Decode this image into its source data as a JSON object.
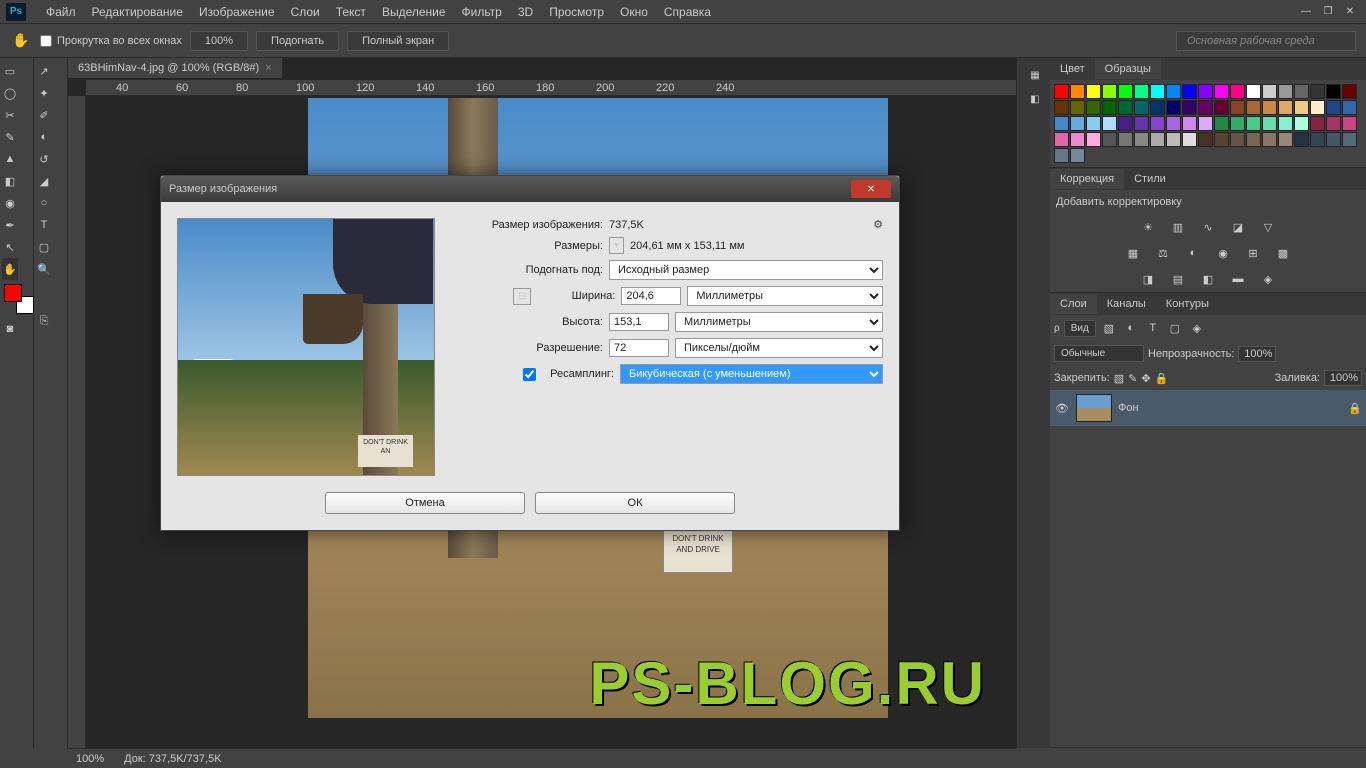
{
  "app": {
    "logo": "Ps"
  },
  "menu": [
    "Файл",
    "Редактирование",
    "Изображение",
    "Слои",
    "Текст",
    "Выделение",
    "Фильтр",
    "3D",
    "Просмотр",
    "Окно",
    "Справка"
  ],
  "opt": {
    "scroll": "Прокрутка во всех окнах",
    "zoom": "100%",
    "fit": "Подогнать",
    "full": "Полный экран",
    "workspace": "Основная рабочая среда"
  },
  "tab": {
    "title": "63BHimNav-4.jpg @ 100% (RGB/8#)"
  },
  "ruler": [
    "40",
    "60",
    "80",
    "100",
    "120",
    "140",
    "160",
    "180",
    "200",
    "220",
    "240"
  ],
  "status": {
    "zoom": "100%",
    "doc": "Док: 737,5K/737,5K"
  },
  "sign": "DON'T\nDRINK AND\nDRIVE",
  "wm": "PS-BLOG.RU",
  "panels": {
    "color_tabs": [
      "Цвет",
      "Образцы"
    ],
    "adj_tabs": [
      "Коррекция",
      "Стили"
    ],
    "adj_add": "Добавить корректировку",
    "lay_tabs": [
      "Слои",
      "Каналы",
      "Контуры"
    ],
    "lay_kind": "Вид",
    "lay_mode": "Обычные",
    "lay_op_label": "Непрозрачность:",
    "lay_op": "100%",
    "lay_lock": "Закрепить:",
    "lay_fill_label": "Заливка:",
    "lay_fill": "100%",
    "layer_name": "Фон"
  },
  "dlg": {
    "title": "Размер изображения",
    "size_label": "Размер изображения:",
    "size_val": "737,5K",
    "dim_label": "Размеры:",
    "dim_val": "204,61 мм x 153,11 мм",
    "fit_label": "Подогнать под:",
    "fit_val": "Исходный размер",
    "w_label": "Ширина:",
    "w_val": "204,6",
    "w_unit": "Миллиметры",
    "h_label": "Высота:",
    "h_val": "153,1",
    "h_unit": "Миллиметры",
    "res_label": "Разрешение:",
    "res_val": "72",
    "res_unit": "Пикселы/дюйм",
    "resample_label": "Ресамплинг:",
    "resample_val": "Бикубическая (с уменьшением)",
    "cancel": "Отмена",
    "ok": "ОК",
    "sign": "DON'T\nDRINK AN"
  },
  "swatches": [
    "#ff0000",
    "#ff8800",
    "#ffff00",
    "#88ff00",
    "#00ff00",
    "#00ff88",
    "#00ffff",
    "#0088ff",
    "#0000ff",
    "#8800ff",
    "#ff00ff",
    "#ff0088",
    "#ffffff",
    "#cccccc",
    "#999999",
    "#666666",
    "#333333",
    "#000000",
    "#660000",
    "#663300",
    "#666600",
    "#336600",
    "#006600",
    "#006633",
    "#006666",
    "#003366",
    "#000066",
    "#330066",
    "#660066",
    "#660033",
    "#884422",
    "#aa6633",
    "#cc8844",
    "#ddaa66",
    "#eecc88",
    "#ffeecc",
    "#224488",
    "#3366aa",
    "#4488cc",
    "#66aadd",
    "#88ccee",
    "#aaddff",
    "#442288",
    "#6633aa",
    "#8844cc",
    "#aa66dd",
    "#cc88ee",
    "#ddaaff",
    "#228844",
    "#33aa66",
    "#44cc88",
    "#66ddaa",
    "#88eecc",
    "#aaffdd",
    "#882244",
    "#aa3366",
    "#cc4488",
    "#dd66aa",
    "#ee88cc",
    "#ffaadd",
    "#555555",
    "#777777",
    "#888888",
    "#aaaaaa",
    "#bbbbbb",
    "#dddddd",
    "#443322",
    "#554433",
    "#665544",
    "#776655",
    "#887766",
    "#998877",
    "#223344",
    "#334455",
    "#445566",
    "#556677",
    "#667788",
    "#778899"
  ]
}
